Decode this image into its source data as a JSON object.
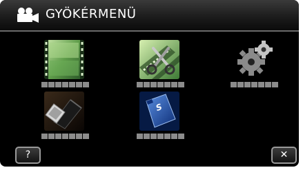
{
  "header": {
    "title": "GYÖKÉRMENÜ",
    "icon": "video-camera-icon"
  },
  "menu": {
    "items": [
      {
        "name": "video-playback-item",
        "icon": "film-strip-icon"
      },
      {
        "name": "edit-item",
        "icon": "scissors-film-icon"
      },
      {
        "name": "settings-item",
        "icon": "gears-icon"
      },
      {
        "name": "connection-item",
        "icon": "hdmi-cable-icon"
      },
      {
        "name": "sd-card-item",
        "icon": "sd-card-icon",
        "card_label": "S"
      }
    ]
  },
  "footer": {
    "help_label": "?",
    "close_label": "✕"
  },
  "colors": {
    "background": "#000000",
    "placeholder_text": "#8c8c8c",
    "accent_blue": "#1e4fa8"
  }
}
